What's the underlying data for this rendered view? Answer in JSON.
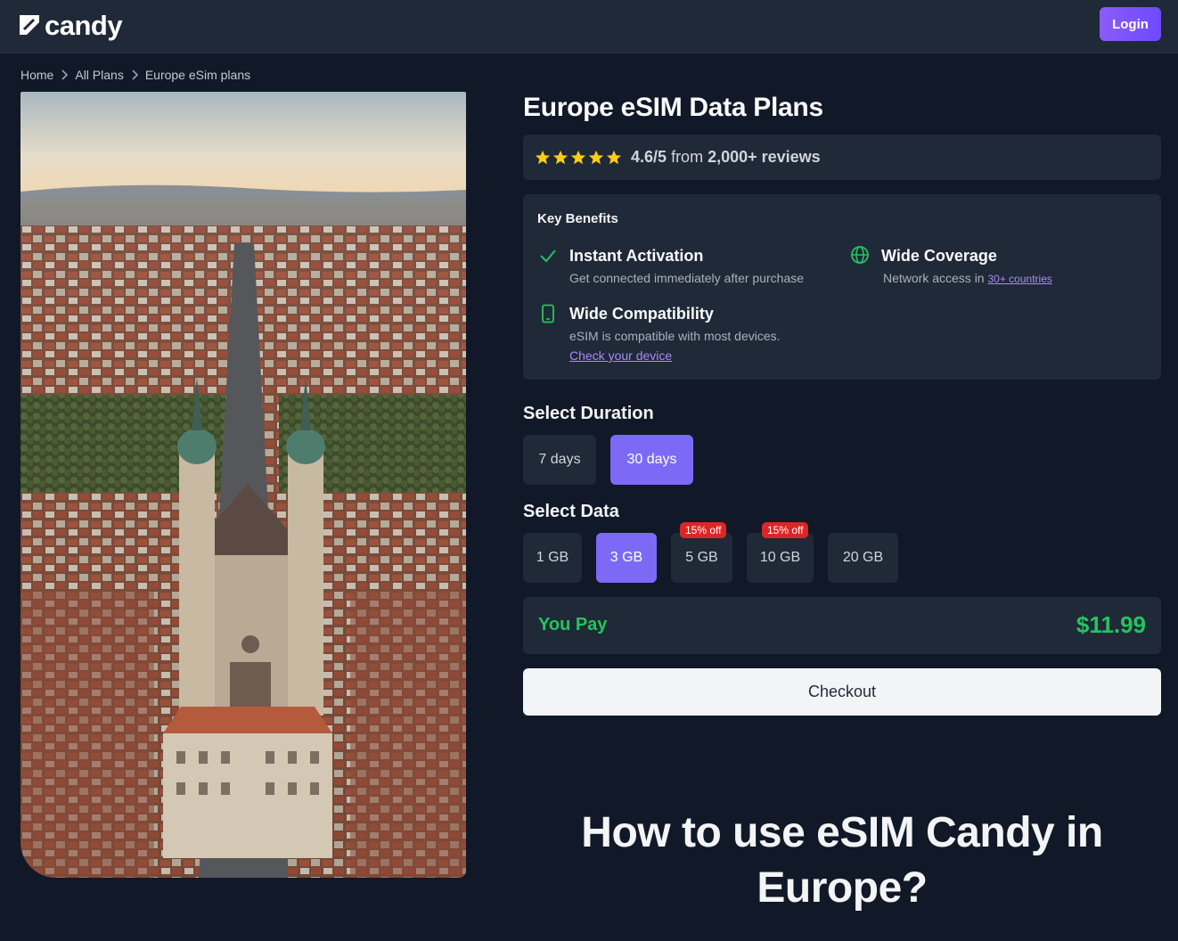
{
  "header": {
    "brand": "candy",
    "login_label": "Login"
  },
  "breadcrumb": {
    "items": [
      "Home",
      "All Plans",
      "Europe eSim plans"
    ]
  },
  "hero_image": {
    "subject": "aerial-city-cathedral-photo"
  },
  "product": {
    "title": "Europe eSIM Data Plans",
    "rating": "4.6/5",
    "rating_from": "from",
    "reviews": "2,000+ reviews",
    "stars": 5
  },
  "benefits": {
    "title": "Key Benefits",
    "instant": {
      "title": "Instant Activation",
      "desc": "Get connected immediately after purchase"
    },
    "coverage": {
      "title": "Wide Coverage",
      "desc": "Network access in",
      "link": "30+ countries"
    },
    "compat": {
      "title": "Wide Compatibility",
      "desc": "eSIM is compatible with most devices.",
      "link": "Check your device"
    }
  },
  "duration": {
    "label": "Select Duration",
    "options": [
      "7 days",
      "30 days"
    ],
    "selected": "30 days"
  },
  "data_options": {
    "label": "Select Data",
    "options": [
      {
        "label": "1 GB",
        "badge": ""
      },
      {
        "label": "3 GB",
        "badge": ""
      },
      {
        "label": "5 GB",
        "badge": "15% off"
      },
      {
        "label": "10 GB",
        "badge": "15% off"
      },
      {
        "label": "20 GB",
        "badge": ""
      }
    ],
    "selected": "3 GB"
  },
  "payment": {
    "label": "You Pay",
    "price": "$11.99",
    "checkout_label": "Checkout"
  },
  "howto": {
    "line1": "How to use eSIM Candy in",
    "line2": "Europe?"
  },
  "colors": {
    "background": "#111827",
    "panel": "#1f2937",
    "accent": "#7c6af6",
    "success": "#22c55e",
    "badge": "#dc2626",
    "star": "#facc15",
    "link": "#a78bfa"
  }
}
